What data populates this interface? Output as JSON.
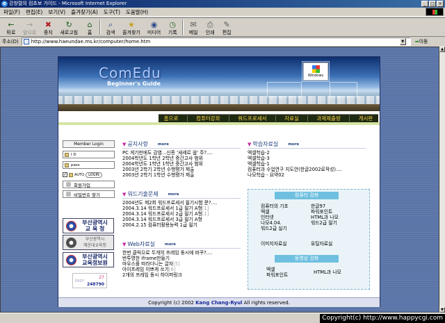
{
  "window": {
    "title": "강창렬의 컴쵸보 가이드 - Microsoft Internet Explorer",
    "buttons": [
      "_",
      "□",
      "×"
    ]
  },
  "menu": [
    "파일(F)",
    "편집(E)",
    "보기(V)",
    "즐겨찾기(A)",
    "도구(T)",
    "도움말(H)"
  ],
  "toolbar": [
    {
      "label": "뒤로",
      "icon": "back-arrow-icon",
      "glyph": "←"
    },
    {
      "label": "앞으로",
      "icon": "forward-arrow-icon",
      "glyph": "→",
      "disabled": true
    },
    {
      "label": "중지",
      "icon": "stop-icon",
      "glyph": "✖"
    },
    {
      "label": "새로고침",
      "icon": "refresh-icon",
      "glyph": "↻"
    },
    {
      "label": "홈",
      "icon": "home-icon",
      "glyph": "⌂"
    },
    {
      "label": "검색",
      "icon": "search-icon",
      "glyph": "⌕"
    },
    {
      "label": "즐겨찾기",
      "icon": "favorites-icon",
      "glyph": "★"
    },
    {
      "label": "미디어",
      "icon": "media-icon",
      "glyph": "◉"
    },
    {
      "label": "기록",
      "icon": "history-icon",
      "glyph": "◷"
    },
    {
      "label": "메일",
      "icon": "mail-icon",
      "glyph": "✉"
    },
    {
      "label": "인쇄",
      "icon": "print-icon",
      "glyph": "⎙"
    },
    {
      "label": "편집",
      "icon": "edit-icon",
      "glyph": "✎"
    }
  ],
  "address": {
    "label": "주소(D)",
    "url": "http://www.haeundae.ms.kr/computer/home.htm",
    "go_label": "이동"
  },
  "site": {
    "brand": "ComEdu",
    "subtitle": "Beginner's Guide",
    "win_logo_text": "Windows",
    "nav": [
      "홈으로",
      "컴퓨터강좌",
      "워드프로세서",
      "자료실",
      "과제제출방",
      "게시판"
    ],
    "login": {
      "title": "Member Login",
      "id_label": "I D",
      "pass_label": "pass",
      "auto_label": "AUTO",
      "login_btn": "LOGIN",
      "join_label": "회원가입",
      "find_pw_label": "비밀번호 찾기"
    },
    "logos": [
      {
        "line1": "부산광역시",
        "line2": "교 육 청"
      },
      {
        "line1": "부산광역시",
        "line2": "해운대교육청"
      },
      {
        "line1": "부산광역시",
        "line2": "교육정보원"
      }
    ],
    "counter": {
      "today": "27",
      "label": "EASY",
      "total": "248790"
    },
    "notices": {
      "title": "공지사항",
      "more": "more",
      "items": [
        "PC 게기판에도 감염...신종 '새세르 웜' 주?....",
        "2004학년도 1학년 2학년 중간고사 범위",
        "2004학년도 1학년 1학년 중간고사 범위",
        "2003년 2학기 2학년 수행평가 제출",
        "2003년 2학기 1학년 수행평가 제출"
      ]
    },
    "word_quiz": {
      "title": "워드기출문제",
      "more": "more",
      "items": [
        {
          "text": "2004년도 제2회 워드프로세서 필기시험 문?....",
          "count": ""
        },
        {
          "text": "2004.3.14 워드프로세서 1급 필기 A형",
          "count": "[1]"
        },
        {
          "text": "2004.3.14 워드프로세서 2급 필기 A형",
          "count": "[1]"
        },
        {
          "text": "2004.3.14 워드프로세서 3급 필기 A형",
          "count": ""
        },
        {
          "text": "2004.2.15 컴퓨터활용능력 1급 필기",
          "count": ""
        }
      ]
    },
    "web_data": {
      "title": "Web자료실",
      "more": "more",
      "items": [
        {
          "text": "한번 클릭으로 두개의 프레임 동시에 바꾸?....",
          "count": ""
        },
        {
          "text": "반투명한 iframe만들기",
          "count": ""
        },
        {
          "text": "마우스를 따라다니는 글자",
          "count": "[5]"
        },
        {
          "text": "아이프레임 이쁘게 쓰기",
          "count": "[6]"
        },
        {
          "text": "2개의 프레임 동시 하이퍼링크",
          "count": ""
        }
      ]
    },
    "study": {
      "title": "학습자료실",
      "more": "more",
      "items": [
        "엑셀학습-2",
        "엑셀학습-3",
        "엑셀학습-1",
        "컴퓨터과 수업연구 지도안(한글2002로작성)....",
        "나모학습 - 요약02"
      ]
    },
    "computer_lecture": {
      "title": "컴퓨터 강좌",
      "items": [
        "컴퓨터의 기초",
        "한글97",
        "엑셀",
        "파워포인트",
        "인터넷",
        "HTML과 나모",
        "나모4.04.",
        "워드2급 필기",
        "워드2급 실기",
        ""
      ]
    },
    "links": [
      "이미지자료실",
      "유틸자료실"
    ],
    "video_lecture": {
      "title": "동영상 강좌",
      "items": [
        "엑셀",
        "HTML과 나모",
        "파워포인트",
        ""
      ]
    },
    "footer": {
      "prefix": "Copyright (c) 2002",
      "name": "Kang Chang-Ryul",
      "suffix": "All rights reserved."
    }
  },
  "watermark": "Copyright(c) http://www.happycgi.com"
}
